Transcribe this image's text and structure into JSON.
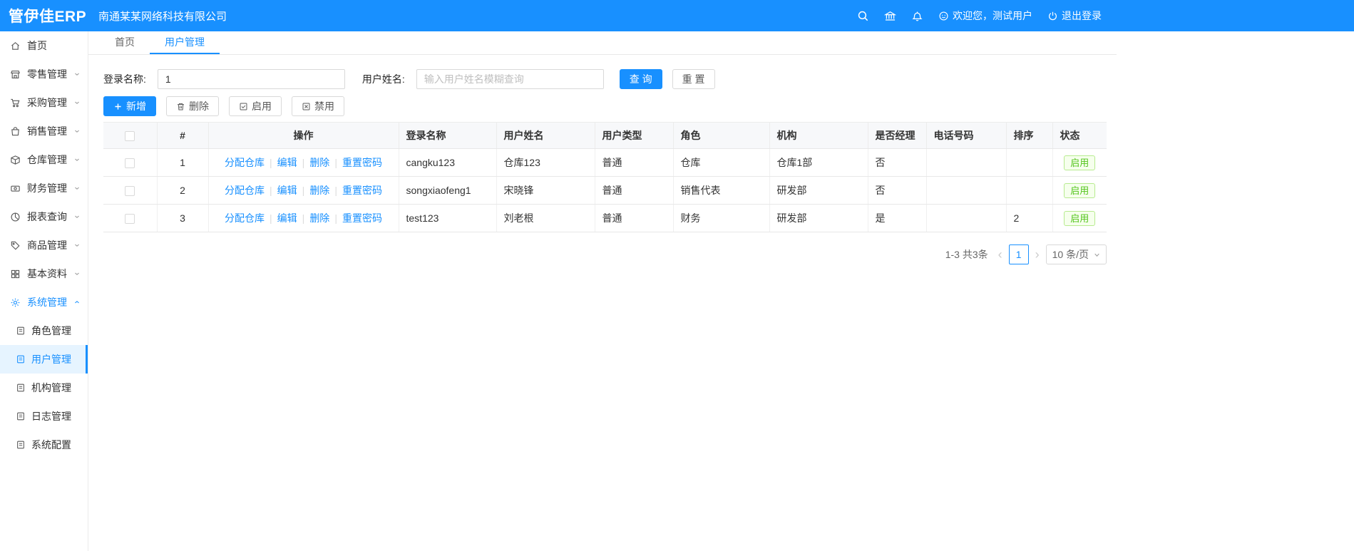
{
  "colors": {
    "accent": "#1890ff",
    "success_green": "#52c41a",
    "topbar_bg": "#1890ff",
    "active_menu_bg": "#e6f4ff"
  },
  "topbar": {
    "logo": "管伊佳ERP",
    "company": "南通某某网络科技有限公司",
    "welcome": "欢迎您，测试用户",
    "logout": "退出登录",
    "icons": [
      "search-icon",
      "bank-icon",
      "bell-icon",
      "user-circle-icon",
      "logout-icon"
    ]
  },
  "sidebar": {
    "items": [
      {
        "label": "首页",
        "icon": "home",
        "expandable": false
      },
      {
        "label": "零售管理",
        "icon": "retail",
        "expandable": true
      },
      {
        "label": "采购管理",
        "icon": "purchase",
        "expandable": true
      },
      {
        "label": "销售管理",
        "icon": "sales",
        "expandable": true
      },
      {
        "label": "仓库管理",
        "icon": "warehouse",
        "expandable": true
      },
      {
        "label": "财务管理",
        "icon": "finance",
        "expandable": true
      },
      {
        "label": "报表查询",
        "icon": "report",
        "expandable": true
      },
      {
        "label": "商品管理",
        "icon": "goods",
        "expandable": true
      },
      {
        "label": "基本资料",
        "icon": "basic-data",
        "expandable": true
      },
      {
        "label": "系统管理",
        "icon": "system",
        "expandable": true,
        "expanded": true,
        "active": true
      }
    ],
    "subitems": [
      {
        "label": "角色管理",
        "icon": "role"
      },
      {
        "label": "用户管理",
        "icon": "user",
        "active": true
      },
      {
        "label": "机构管理",
        "icon": "org"
      },
      {
        "label": "日志管理",
        "icon": "log"
      },
      {
        "label": "系统配置",
        "icon": "config"
      }
    ]
  },
  "tabs": [
    {
      "label": "首页",
      "active": false
    },
    {
      "label": "用户管理",
      "active": true
    }
  ],
  "filters": {
    "login_label": "登录名称:",
    "login_value": "1",
    "name_label": "用户姓名:",
    "name_placeholder": "输入用户姓名模糊查询",
    "search_label": "查 询",
    "reset_label": "重 置"
  },
  "toolbar": {
    "add": "新增",
    "delete": "删除",
    "enable": "启用",
    "disable": "禁用"
  },
  "table": {
    "headers": {
      "index": "#",
      "op": "操作",
      "login": "登录名称",
      "name": "用户姓名",
      "type": "用户类型",
      "role": "角色",
      "org": "机构",
      "manager": "是否经理",
      "phone": "电话号码",
      "sort": "排序",
      "status": "状态"
    },
    "op_links": {
      "assign": "分配仓库",
      "edit": "编辑",
      "del": "删除",
      "reset_pwd": "重置密码"
    },
    "rows": [
      {
        "index": "1",
        "login": "cangku123",
        "name": "仓库123",
        "type": "普通",
        "role": "仓库",
        "org": "仓库1部",
        "manager": "否",
        "phone": "",
        "sort": "",
        "status": "启用"
      },
      {
        "index": "2",
        "login": "songxiaofeng1",
        "name": "宋晓锋",
        "type": "普通",
        "role": "销售代表",
        "org": "研发部",
        "manager": "否",
        "phone": "",
        "sort": "",
        "status": "启用"
      },
      {
        "index": "3",
        "login": "test123",
        "name": "刘老根",
        "type": "普通",
        "role": "财务",
        "org": "研发部",
        "manager": "是",
        "phone": "",
        "sort": "2",
        "status": "启用"
      }
    ]
  },
  "pagination": {
    "total": "1-3 共3条",
    "prev": "‹",
    "page": "1",
    "next": "›",
    "size": "10 条/页"
  }
}
